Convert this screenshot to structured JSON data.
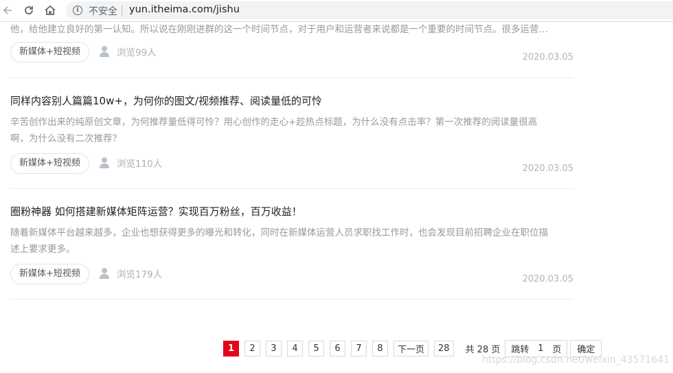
{
  "browser": {
    "security_label": "不安全",
    "url": "yun.itheima.com/jishu"
  },
  "articles": [
    {
      "title": "",
      "summary_lines": [
        "他，给他建立良好的第一认知。所以说在刚刚进群的这一个时间节点，对于用户和运营者来说都是一个重要的时间节点。很多运营…"
      ],
      "tag": "新媒体+短视频",
      "views": "浏览99人",
      "date": "2020.03.05"
    },
    {
      "title": "同样内容别人篇篇10w+，为何你的图文/视频推荐、阅读量低的可怜",
      "summary_lines": [
        "辛苦创作出来的纯原创文章，为何推荐量低得可怜？用心创作的走心+趁热点标题，为什么没有点击率？第一次推荐的阅读量很高",
        "啊，为什么没有二次推荐？"
      ],
      "tag": "新媒体+短视频",
      "views": "浏览110人",
      "date": "2020.03.05"
    },
    {
      "title": "圈粉神器 如何搭建新媒体矩阵运营？实现百万粉丝，百万收益！",
      "summary_lines": [
        "随着新媒体平台越来越多，企业也想获得更多的曝光和转化，同时在新媒体运营人员求职找工作时，也会发现目前招聘企业在职位描",
        "述上要求更多。"
      ],
      "tag": "新媒体+短视频",
      "views": "浏览179人",
      "date": "2020.03.05"
    }
  ],
  "pagination": {
    "pages": [
      "1",
      "2",
      "3",
      "4",
      "5",
      "6",
      "7",
      "8"
    ],
    "current": "1",
    "next_label": "下一页",
    "last_page": "28",
    "total_label": "共 28 页",
    "jump_label": "跳转",
    "jump_value": "1",
    "page_unit": "页",
    "confirm_label": "确定"
  },
  "watermark": "https://blog.csdn.net/weixin_43571641",
  "colors": {
    "accent": "#e4051b"
  }
}
